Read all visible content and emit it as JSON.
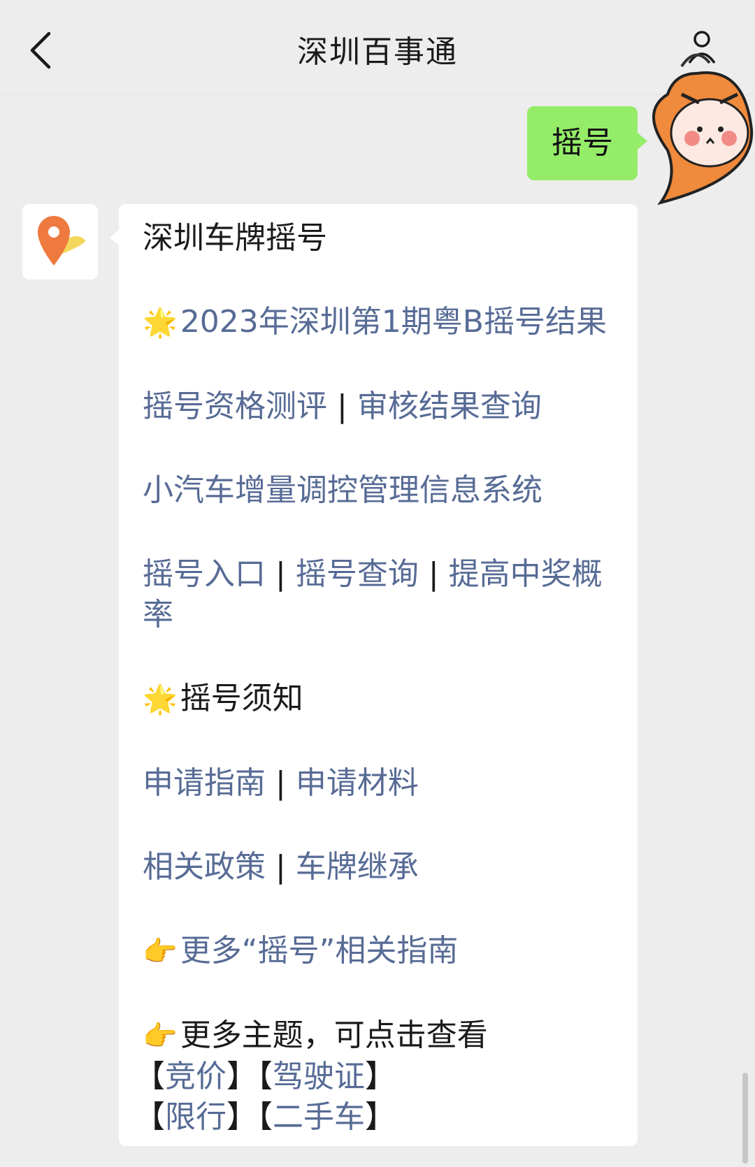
{
  "header": {
    "title": "深圳百事通",
    "back_icon": "chevron-left-icon",
    "profile_icon": "person-icon"
  },
  "user_message": "摇号",
  "bot_message": {
    "heading": "深圳车牌摇号",
    "item_result": "2023年深圳第1期粤B摇号结果",
    "item_qual_a": "摇号资格测评",
    "item_qual_b": "审核结果查询",
    "item_system": "小汽车增量调控管理信息系统",
    "item_entry_a": "摇号入口",
    "item_entry_b": "摇号查询",
    "item_entry_c": "提高中奖概",
    "item_entry_c2": "率",
    "notice_heading": "摇号须知",
    "item_guide_a": "申请指南",
    "item_guide_b": "申请材料",
    "item_policy_a": "相关政策",
    "item_policy_b": "车牌继承",
    "more_guides": "更多“摇号”相关指南",
    "more_topics": "更多主题，可点击查看",
    "topic_bid": "竞价",
    "topic_license": "驾驶证",
    "topic_limit": "限行",
    "topic_used_car": "二手车",
    "separator": "|",
    "bracket_open": "【",
    "bracket_close": "】"
  },
  "colors": {
    "link": "#576b95",
    "user_bubble": "#95ec69",
    "background": "#ededed"
  }
}
